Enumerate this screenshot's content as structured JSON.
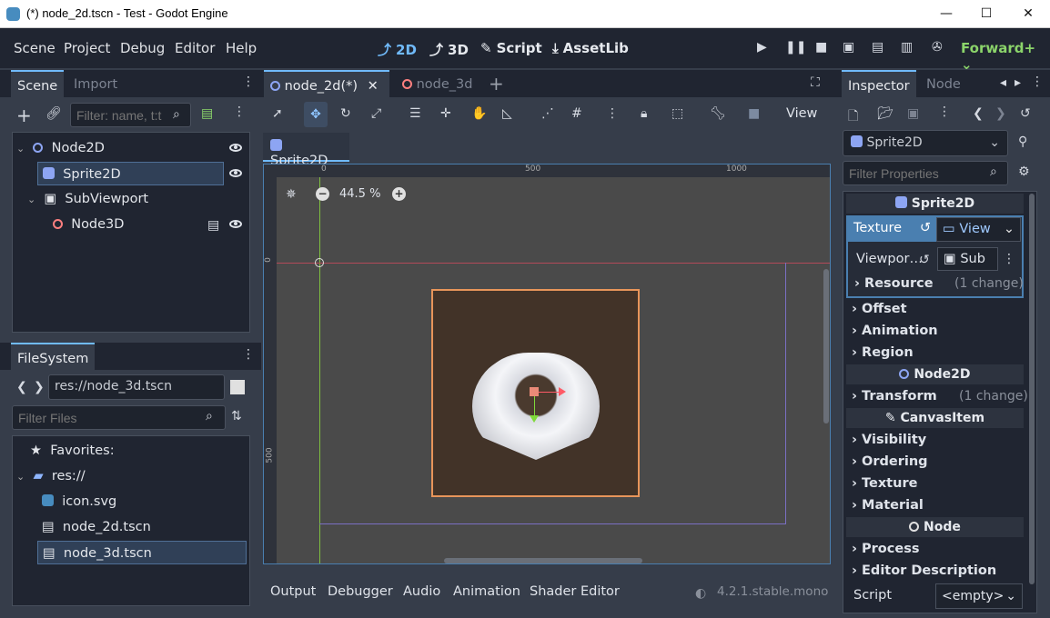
{
  "window": {
    "title": "(*) node_2d.tscn - Test - Godot Engine",
    "min": "—",
    "max": "☐",
    "close": "✕"
  },
  "menu": [
    "Scene",
    "Project",
    "Debug",
    "Editor",
    "Help"
  ],
  "main_screens": {
    "two_d": "2D",
    "three_d": "3D",
    "script": "Script",
    "assetlib": "AssetLib"
  },
  "renderer": "Forward+",
  "scene_dock": {
    "tabs": [
      "Scene",
      "Import"
    ],
    "filter_placeholder": "Filter: name, t:t",
    "nodes": [
      {
        "name": "Node2D"
      },
      {
        "name": "Sprite2D"
      },
      {
        "name": "SubViewport"
      },
      {
        "name": "Node3D"
      }
    ]
  },
  "filesystem": {
    "title": "FileSystem",
    "path": "res://node_3d.tscn",
    "filter_placeholder": "Filter Files",
    "items": [
      {
        "name": "Favorites:"
      },
      {
        "name": "res://"
      },
      {
        "name": "icon.svg"
      },
      {
        "name": "node_2d.tscn"
      },
      {
        "name": "node_3d.tscn"
      }
    ]
  },
  "editor_tabs": [
    {
      "label": "node_2d(*)"
    },
    {
      "label": "node_3d"
    }
  ],
  "toolbar": {
    "view": "View"
  },
  "subtab": "Sprite2D",
  "zoom": "44.5 %",
  "ruler": {
    "h": [
      "0",
      "500",
      "1000"
    ],
    "v": [
      "0",
      "500"
    ]
  },
  "bottom_tabs": [
    "Output",
    "Debugger",
    "Audio",
    "Animation",
    "Shader Editor"
  ],
  "version": "4.2.1.stable.mono",
  "inspector": {
    "tabs": [
      "Inspector",
      "Node"
    ],
    "object": "Sprite2D",
    "filter_placeholder": "Filter Properties",
    "sections": {
      "sprite": "Sprite2D",
      "node2d": "Node2D",
      "canvasitem": "CanvasItem",
      "node": "Node"
    },
    "texture_label": "Texture",
    "texture_value": "View",
    "viewport_label": "Viewpor…",
    "viewport_value": "Sub",
    "resource": "Resource",
    "resource_change": "(1 change)",
    "sprite_props": [
      "Offset",
      "Animation",
      "Region"
    ],
    "transform": "Transform",
    "transform_change": "(1 change)",
    "canvas_props": [
      "Visibility",
      "Ordering",
      "Texture",
      "Material"
    ],
    "node_props": [
      "Process",
      "Editor Description"
    ],
    "script_label": "Script",
    "script_value": "<empty>"
  }
}
